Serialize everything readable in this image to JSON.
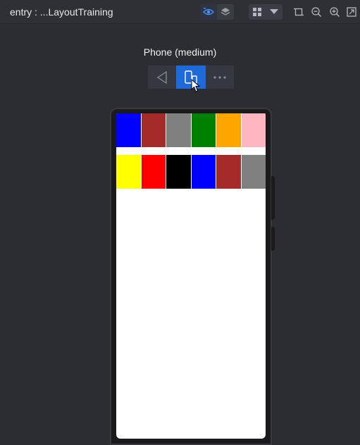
{
  "window": {
    "title": "entry : ...LayoutTraining"
  },
  "toolbar": {
    "icons": [
      "eye-icon",
      "layers-icon",
      "grid-icon",
      "dropdown-arrow-icon",
      "crop-icon",
      "zoom-out-icon",
      "zoom-in-icon",
      "fit-screen-icon"
    ]
  },
  "device": {
    "label": "Phone (medium)"
  },
  "colors": {
    "accent": "#1f6ad9",
    "background": "#2b2d33"
  },
  "grid": {
    "rows": [
      [
        "#0000ff",
        "#a52a2a",
        "#808080",
        "#008000",
        "#ffa500",
        "#ffb6c1"
      ],
      [
        "#ffff00",
        "#ff0000",
        "#000000",
        "#0000ff",
        "#a52a2a",
        "#808080"
      ]
    ]
  }
}
